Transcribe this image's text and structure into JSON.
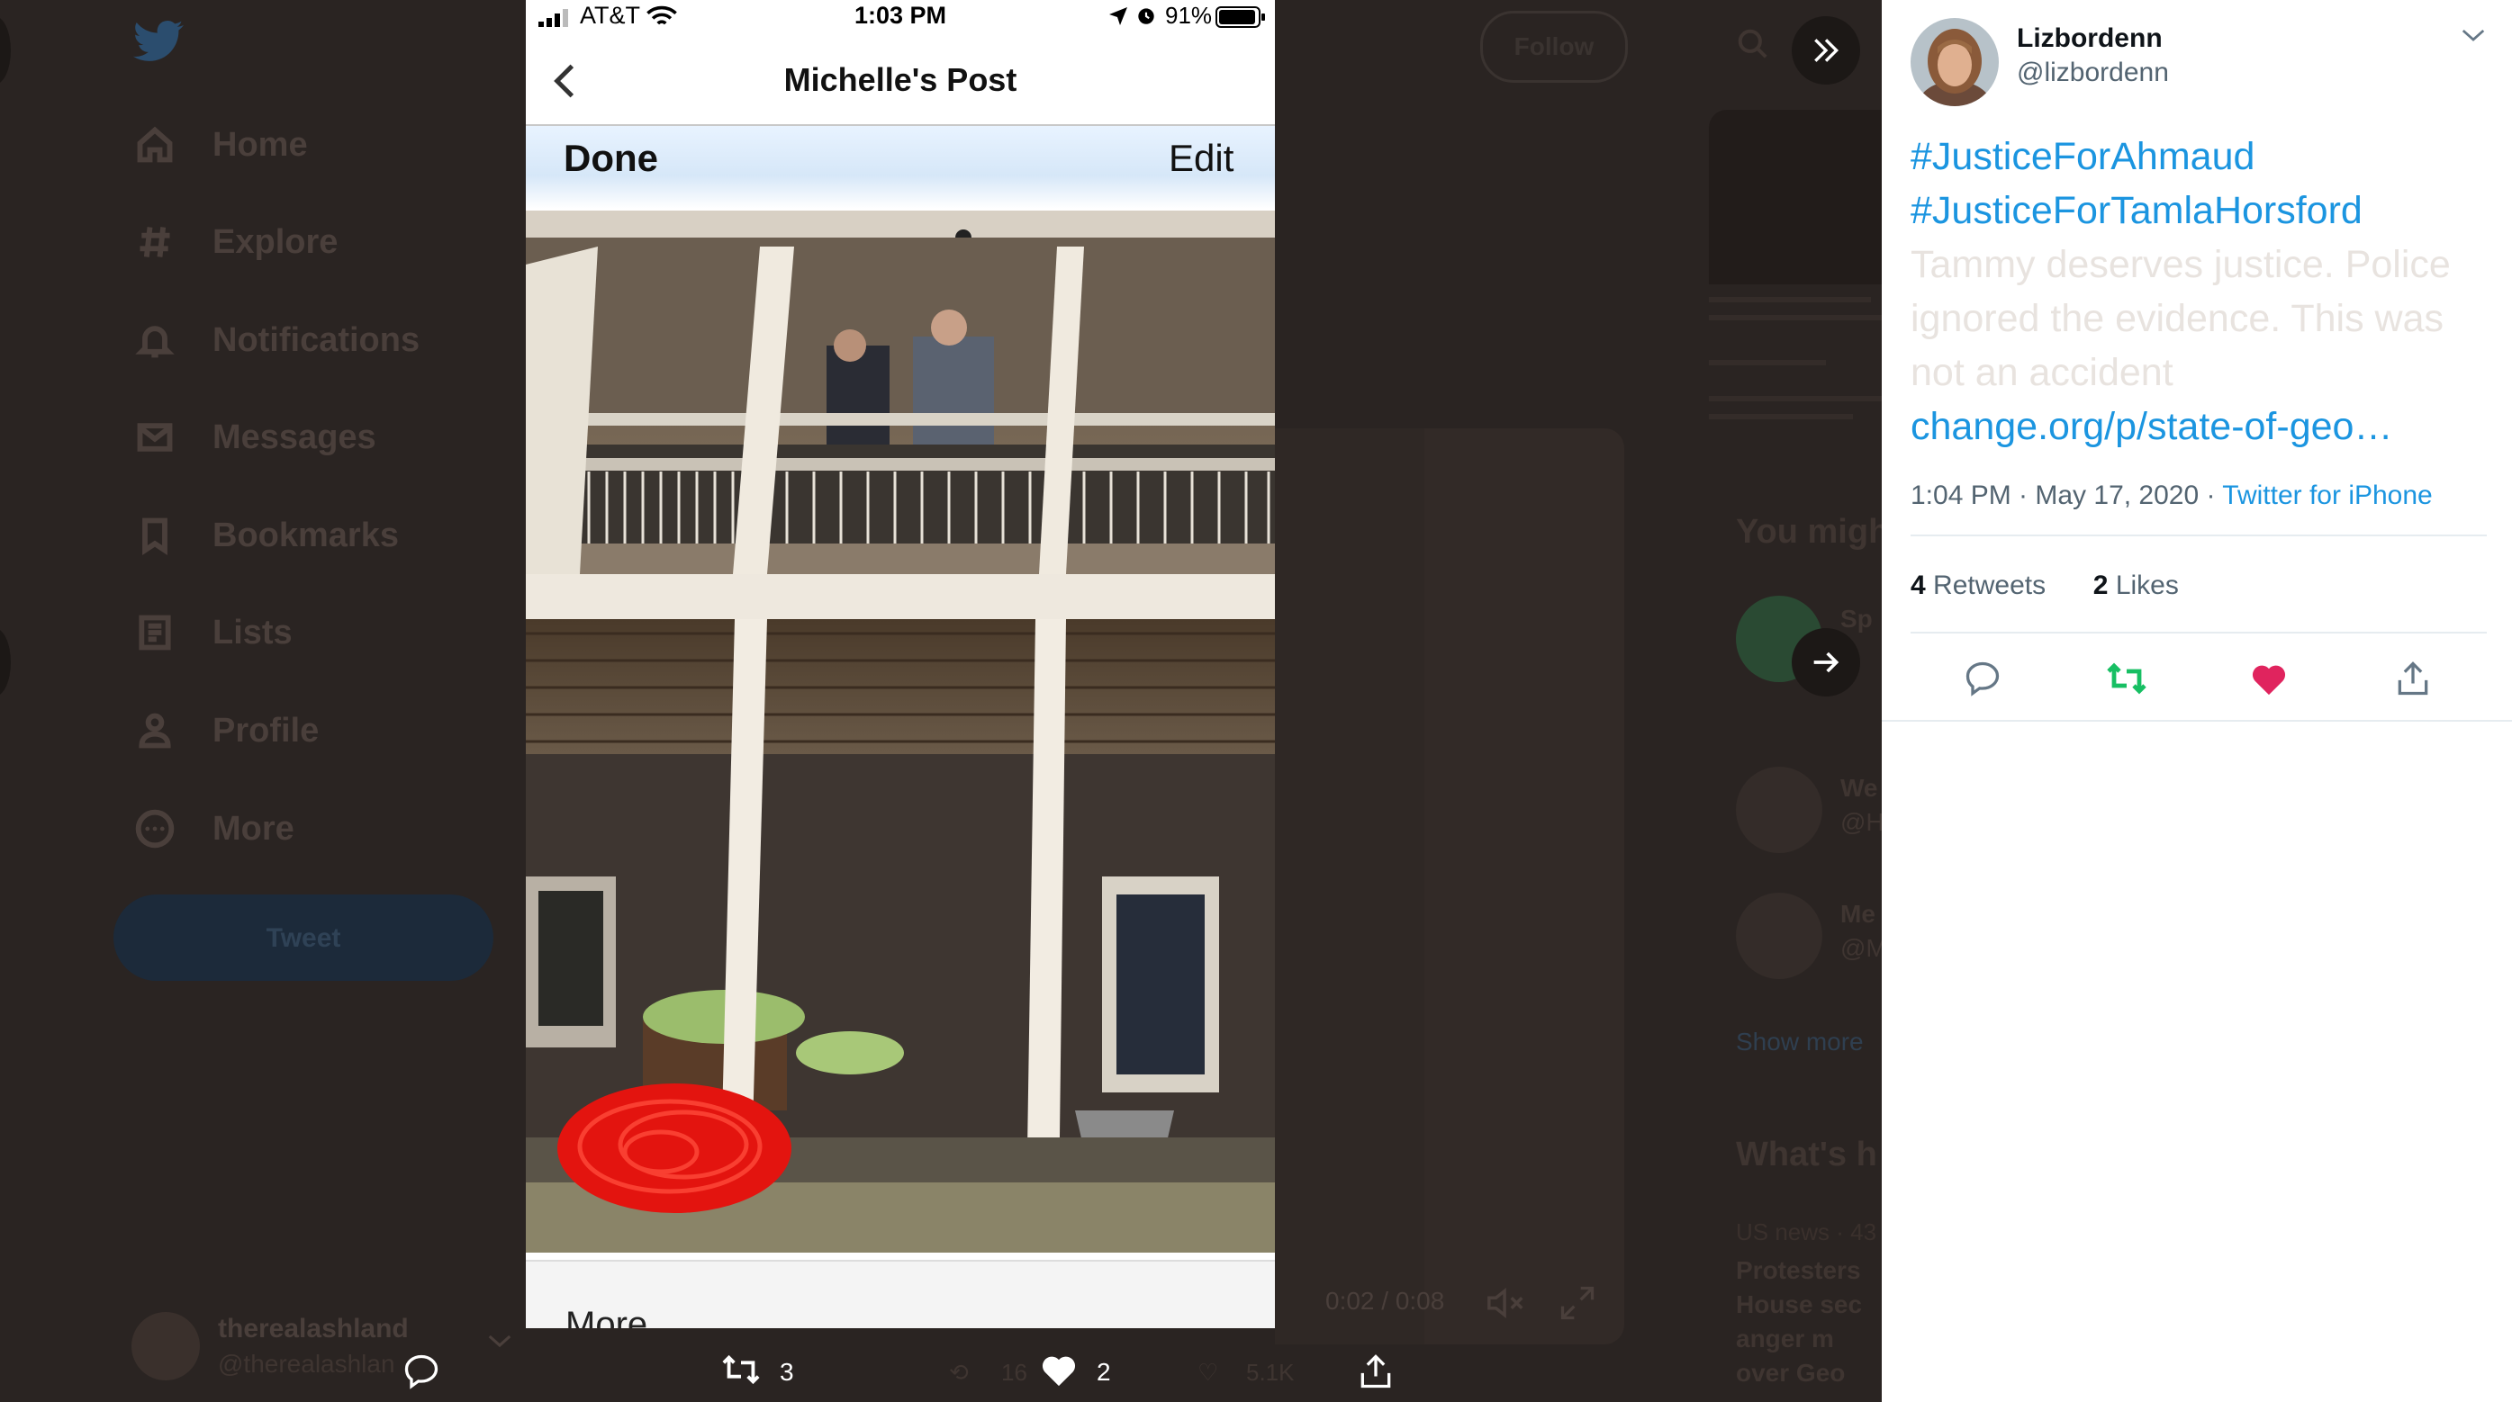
{
  "background": {
    "nav": {
      "items": [
        {
          "label": "Home",
          "icon": "home-icon"
        },
        {
          "label": "Explore",
          "icon": "hashtag-icon"
        },
        {
          "label": "Notifications",
          "icon": "bell-icon"
        },
        {
          "label": "Messages",
          "icon": "envelope-icon"
        },
        {
          "label": "Bookmarks",
          "icon": "bookmark-icon"
        },
        {
          "label": "Lists",
          "icon": "list-icon"
        },
        {
          "label": "Profile",
          "icon": "person-icon"
        },
        {
          "label": "More",
          "icon": "more-circle-icon"
        }
      ],
      "tweet_button": "Tweet"
    },
    "account": {
      "name": "therealashland",
      "handle": "@therealashlan"
    },
    "follow_button": "Follow",
    "video_time": "0:02 / 0:08",
    "sidebar": {
      "you_might": "You migh",
      "suggestions": [
        "Sp",
        "We",
        "Me"
      ],
      "suggestion_handles": [
        "",
        "@H",
        "@M"
      ],
      "show_more": "Show more",
      "whats_happening": "What's h",
      "us_news": "US news · 43",
      "trend_lines": [
        "Protesters",
        "House sec",
        "anger m",
        "over Geo"
      ]
    },
    "faded_counts": [
      "16",
      "5.1K"
    ]
  },
  "media": {
    "status": {
      "carrier": "AT&T",
      "time": "1:03 PM",
      "battery": "91%"
    },
    "title": "Michelle's Post",
    "done": "Done",
    "edit": "Edit",
    "more": "More"
  },
  "media_actions": {
    "retweets": "3",
    "likes": "2"
  },
  "tweet": {
    "name": "Lizbordenn",
    "handle": "@lizbordenn",
    "hashtag1": "#JusticeForAhmaud",
    "hashtag2": "#JusticeForTamlaHorsford",
    "lines": [
      "Tammy deserves justice. Police",
      "ignored the evidence. This was",
      "not an accident"
    ],
    "link": "change.org/p/state-of-geo…",
    "time": "1:04 PM · May 17, 2020",
    "sep": " · ",
    "source": "Twitter for iPhone",
    "retweets_count": "4",
    "retweets_label": "Retweets",
    "likes_count": "2",
    "likes_label": "Likes"
  },
  "colors": {
    "link": "#1b95e0",
    "retweet_green": "#17bf63",
    "like_red": "#e0245e",
    "overlay_bg": "#2a2422"
  }
}
